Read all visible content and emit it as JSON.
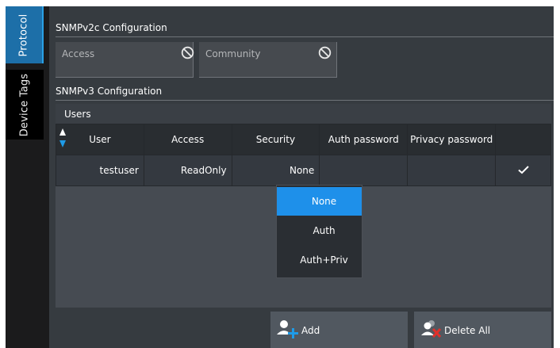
{
  "side_tabs": [
    {
      "label": "Protocol",
      "active": true
    },
    {
      "label": "Device Tags",
      "active": false
    }
  ],
  "snmpv2c": {
    "title": "SNMPv2c Configuration",
    "access_label": "Access",
    "community_label": "Community"
  },
  "snmpv3": {
    "title": "SNMPv3 Configuration",
    "users_title": "Users",
    "columns": [
      "User",
      "Access",
      "Security",
      "Auth password",
      "Privacy password",
      ""
    ],
    "rows": [
      {
        "user": "testuser",
        "access": "ReadOnly",
        "security": "None",
        "auth_password": "",
        "privacy_password": "",
        "enabled_icon": "checkmark-icon"
      }
    ]
  },
  "security_dropdown": {
    "options": [
      "None",
      "Auth",
      "Auth+Priv"
    ],
    "selected": "None"
  },
  "buttons": {
    "add_label": "Add",
    "delete_all_label": "Delete All"
  },
  "colors": {
    "accent": "#1e90ea",
    "active_tab": "#1d6fa8",
    "panel": "#363b40"
  }
}
